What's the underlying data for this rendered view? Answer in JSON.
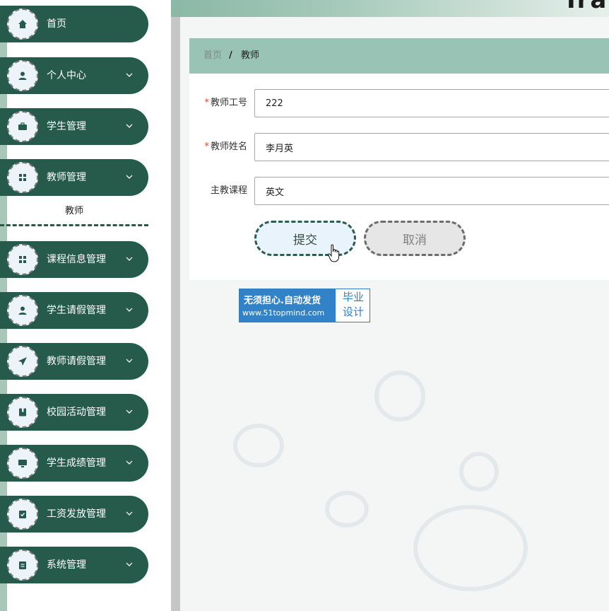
{
  "header": {
    "title_fragment": "Ira"
  },
  "sidebar": {
    "items": [
      {
        "label": "首页",
        "icon": "home-icon",
        "has_chevron": false
      },
      {
        "label": "个人中心",
        "icon": "user-icon",
        "has_chevron": true
      },
      {
        "label": "学生管理",
        "icon": "briefcase-icon",
        "has_chevron": true
      },
      {
        "label": "教师管理",
        "icon": "grid-icon",
        "has_chevron": true
      },
      {
        "label": "课程信息管理",
        "icon": "grid-icon",
        "has_chevron": true
      },
      {
        "label": "学生请假管理",
        "icon": "user-icon",
        "has_chevron": true
      },
      {
        "label": "教师请假管理",
        "icon": "send-icon",
        "has_chevron": true
      },
      {
        "label": "校园活动管理",
        "icon": "book-icon",
        "has_chevron": true
      },
      {
        "label": "学生成绩管理",
        "icon": "monitor-icon",
        "has_chevron": true
      },
      {
        "label": "工资发放管理",
        "icon": "clipboard-check-icon",
        "has_chevron": true
      },
      {
        "label": "系统管理",
        "icon": "clipboard-icon",
        "has_chevron": true
      }
    ],
    "submenu": {
      "label": "教师"
    }
  },
  "breadcrumb": {
    "home": "首页",
    "separator": "/",
    "current": "教师"
  },
  "form": {
    "teacher_id": {
      "label": "教师工号",
      "value": "222",
      "required": true
    },
    "teacher_name": {
      "label": "教师姓名",
      "value": "李月英",
      "required": true
    },
    "main_course": {
      "label": "主教课程",
      "value": "英文",
      "required": false
    },
    "required_mark": "*",
    "submit_label": "提交",
    "cancel_label": "取消"
  },
  "watermark": {
    "line1": "无须担心.自动发货",
    "line2": "www.51topmind.com",
    "right1": "毕业",
    "right2": "设计"
  },
  "colors": {
    "sidebar_item": "#265b4b",
    "breadcrumb_bg": "#99c3b5",
    "required": "#e0492e",
    "watermark_blue": "#3182c6"
  }
}
